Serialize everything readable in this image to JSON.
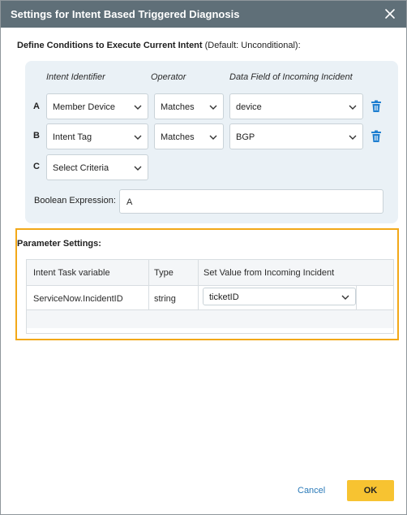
{
  "dialog": {
    "title": "Settings for Intent Based Triggered Diagnosis",
    "close_icon": "close-icon"
  },
  "conditions": {
    "heading": "Define Conditions to Execute Current Intent",
    "heading_note": "(Default: Unconditional):",
    "columns": {
      "identifier": "Intent Identifier",
      "operator": "Operator",
      "data_field": "Data Field of Incoming Incident"
    },
    "rows": [
      {
        "letter": "A",
        "identifier": "Member Device",
        "operator": "Matches",
        "data_field": "device"
      },
      {
        "letter": "B",
        "identifier": "Intent Tag",
        "operator": "Matches",
        "data_field": "BGP"
      },
      {
        "letter": "C",
        "identifier": "Select Criteria"
      }
    ],
    "boolean_label": "Boolean Expression:",
    "boolean_value": "A"
  },
  "parameters": {
    "title": "Parameter Settings:",
    "columns": [
      "Intent Task variable",
      "Type",
      "Set Value from Incoming Incident"
    ],
    "rows": [
      {
        "variable": "ServiceNow.IncidentID",
        "type": "string",
        "value": "ticketID"
      }
    ]
  },
  "footer": {
    "cancel_label": "Cancel",
    "ok_label": "OK"
  },
  "colors": {
    "titlebar": "#5f6f78",
    "panel": "#eaf1f6",
    "highlight": "#f2a818",
    "ok_button": "#f7c331",
    "trash_icon": "#1f7fd0",
    "cancel_link": "#2a7ab8"
  }
}
